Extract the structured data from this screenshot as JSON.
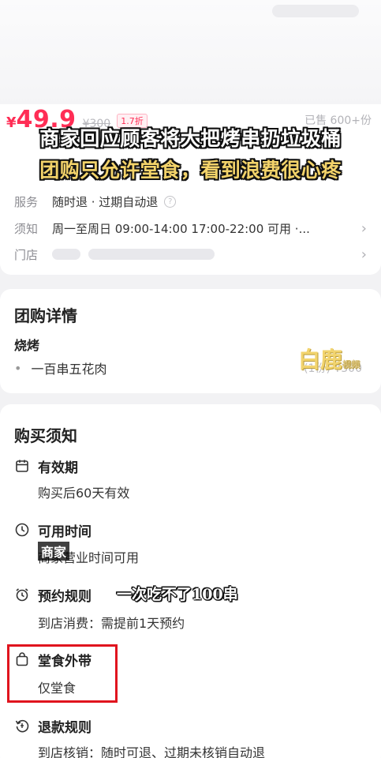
{
  "deal": {
    "price_symbol": "¥",
    "price": "49.9",
    "original_price": "¥300",
    "discount": "1.7折",
    "sold": "已售 600+份"
  },
  "subtitles": {
    "line1": "商家回应顾客将大把烤串扔垃圾桶",
    "line2": "团购只允许堂食，看到浪费很心疼",
    "caption_small": "商家",
    "caption_main": "一次吃不了100串"
  },
  "info_rows": [
    {
      "label": "服务",
      "value": "随时退 · 过期自动退"
    },
    {
      "label": "须知",
      "value": "周一至周日 09:00-14:00 17:00-22:00 可用 ·..."
    },
    {
      "label": "门店",
      "value": ""
    }
  ],
  "detail": {
    "section_title": "团购详情",
    "category": "烧烤",
    "item_name": "一百串五花肉",
    "item_qty_price": "(1份) ¥300"
  },
  "notice": {
    "section_title": "购买须知",
    "items": [
      {
        "title": "有效期",
        "desc": "购买后60天有效",
        "icon": "calendar-icon"
      },
      {
        "title": "可用时间",
        "desc": "商家营业时间可用",
        "icon": "clock-icon"
      },
      {
        "title": "预约规则",
        "desc": "到店消费：需提前1天预约",
        "icon": "alarm-clock-icon"
      },
      {
        "title": "堂食外带",
        "desc": "仅堂食",
        "icon": "bag-icon"
      },
      {
        "title": "退款规则",
        "desc": "到店核销：随时可退、过期未核销自动退",
        "icon": "refund-icon"
      }
    ]
  },
  "watermark": {
    "text": "白鹿",
    "sub": "视频"
  },
  "colors": {
    "accent": "#ff2d55",
    "highlight_box": "#e0141e",
    "subtitle_yellow": "#f3d36a"
  }
}
